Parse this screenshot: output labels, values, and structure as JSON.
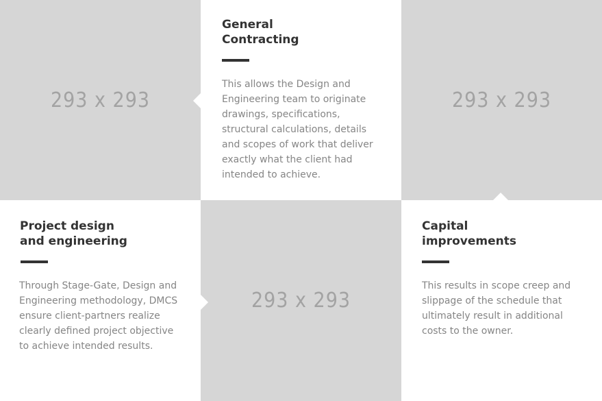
{
  "placeholders": {
    "top_left": "293 x 293",
    "top_right": "293 x 293",
    "bottom_middle": "293 x 293"
  },
  "cards": {
    "general_contracting": {
      "title_line1": "General",
      "title_line2": "Contracting",
      "body": "This allows the Design and Engineering team to originate drawings, specifications, structural calculations, details and scopes of work that deliver exactly what the client had intended to achieve."
    },
    "project_design": {
      "title_line1": "Project design",
      "title_line2": "and engineering",
      "body": "Through Stage-Gate, Design and Engineering methodology, DMCS ensure client-partners realize clearly defined project objective to achieve intended results."
    },
    "capital_improvements": {
      "title_line1": "Capital",
      "title_line2": "improvements",
      "body": "This results in scope creep and slippage of the schedule that ultimately result in additional costs to the owner."
    }
  },
  "colors": {
    "placeholder_bg": "#d6d6d6",
    "placeholder_text": "#a3a3a3",
    "title": "#333333",
    "body": "#858585"
  }
}
